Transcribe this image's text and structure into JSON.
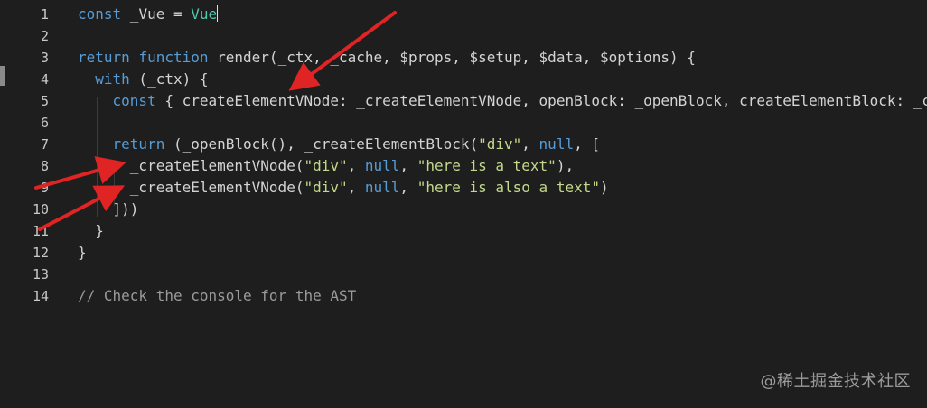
{
  "editor": {
    "lines": [
      {
        "num": "1",
        "tokens": [
          [
            "kw",
            "const"
          ],
          [
            "id",
            " _Vue = "
          ],
          [
            "vue",
            "Vue"
          ]
        ],
        "cursor": true
      },
      {
        "num": "2",
        "tokens": []
      },
      {
        "num": "3",
        "tokens": [
          [
            "kw",
            "return"
          ],
          [
            "id",
            " "
          ],
          [
            "kw",
            "function"
          ],
          [
            "id",
            " render(_ctx, _cache, $props, $setup, $data, $options) {"
          ]
        ]
      },
      {
        "num": "4",
        "tokens": [
          [
            "id",
            "  "
          ],
          [
            "kw",
            "with"
          ],
          [
            "id",
            " (_ctx) {"
          ]
        ]
      },
      {
        "num": "5",
        "tokens": [
          [
            "id",
            "    "
          ],
          [
            "kw",
            "const"
          ],
          [
            "id",
            " { createElementVNode: _createElementVNode, openBlock: _openBlock, createElementBlock: _c"
          ]
        ]
      },
      {
        "num": "6",
        "tokens": []
      },
      {
        "num": "7",
        "tokens": [
          [
            "id",
            "    "
          ],
          [
            "kw",
            "return"
          ],
          [
            "id",
            " (_openBlock(), _createElementBlock("
          ],
          [
            "strg",
            "\"div\""
          ],
          [
            "id",
            ", "
          ],
          [
            "kw",
            "null"
          ],
          [
            "id",
            ", ["
          ]
        ]
      },
      {
        "num": "8",
        "tokens": [
          [
            "id",
            "      _createElementVNode("
          ],
          [
            "strg",
            "\"div\""
          ],
          [
            "id",
            ", "
          ],
          [
            "kw",
            "null"
          ],
          [
            "id",
            ", "
          ],
          [
            "strg",
            "\"here is a text\""
          ],
          [
            "id",
            "),"
          ]
        ]
      },
      {
        "num": "9",
        "tokens": [
          [
            "id",
            "      _createElementVNode("
          ],
          [
            "strg",
            "\"div\""
          ],
          [
            "id",
            ", "
          ],
          [
            "kw",
            "null"
          ],
          [
            "id",
            ", "
          ],
          [
            "strg",
            "\"here is also a text\""
          ],
          [
            "id",
            ")"
          ]
        ]
      },
      {
        "num": "10",
        "tokens": [
          [
            "id",
            "    ]))"
          ]
        ]
      },
      {
        "num": "11",
        "tokens": [
          [
            "id",
            "  }"
          ]
        ]
      },
      {
        "num": "12",
        "tokens": [
          [
            "id",
            "}"
          ]
        ]
      },
      {
        "num": "13",
        "tokens": []
      },
      {
        "num": "14",
        "tokens": [
          [
            "com",
            "// Check the console for the AST"
          ]
        ]
      }
    ]
  },
  "watermark": "@稀土掘金技术社区",
  "colors": {
    "background": "#1e1e1e",
    "keyword": "#569cd6",
    "identifier": "#d4d4d4",
    "string": "#c3d98a",
    "comment": "#9a9a9a",
    "type": "#4ec9b0",
    "annotation_arrow": "#e02424"
  }
}
